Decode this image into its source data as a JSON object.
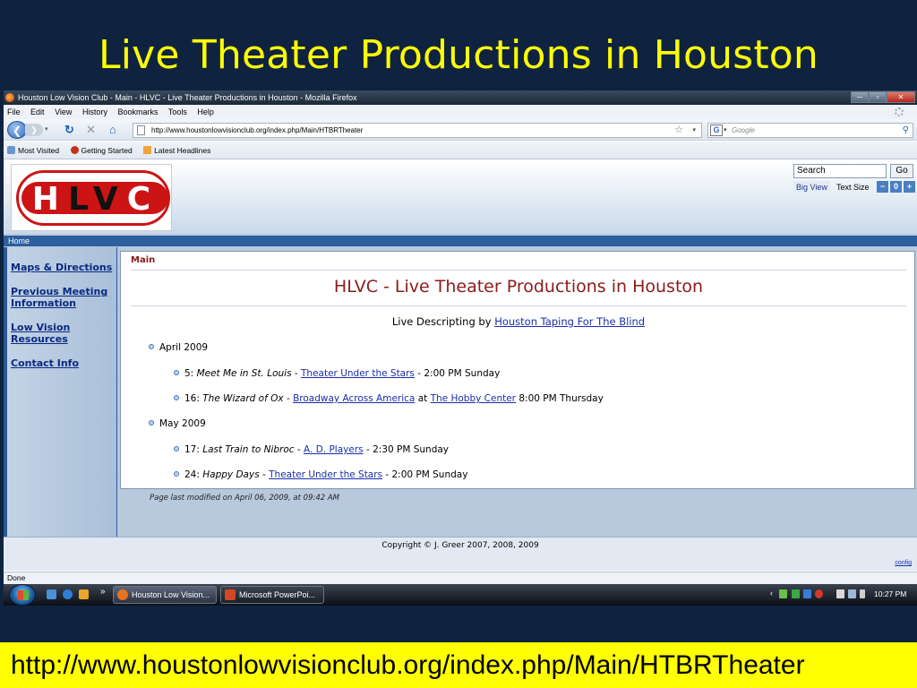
{
  "slide": {
    "title": "Live Theater Productions in Houston",
    "url_caption": "http://www.houstonlowvisionclub.org/index.php/Main/HTBRTheater"
  },
  "window": {
    "title": "Houston Low Vision Club - Main - HLVC - Live Theater Productions in Houston - Mozilla Firefox",
    "minimize": "─",
    "maximize": "▫",
    "close": "✕"
  },
  "menu": [
    "File",
    "Edit",
    "View",
    "History",
    "Bookmarks",
    "Tools",
    "Help"
  ],
  "navbar": {
    "url": "http://www.houstonlowvisionclub.org/index.php/Main/HTBRTheater",
    "search_placeholder": "Google",
    "search_engine": "G"
  },
  "bookmarks": [
    "Most Visited",
    "Getting Started",
    "Latest Headlines"
  ],
  "site": {
    "logo": {
      "left": "H",
      "middle": "LV",
      "right": "C"
    },
    "search_value": "Search",
    "go_label": "Go",
    "big_view": "Big View",
    "text_size": "Text Size",
    "size_minus": "−",
    "size_zero": "0",
    "size_plus": "+",
    "home_link": "Home",
    "sidebar": [
      "Maps & Directions",
      "Previous Meeting Information",
      "Low Vision Resources",
      "Contact Info"
    ],
    "breadcrumb": "Main",
    "page_title": "HLVC - Live Theater Productions in Houston",
    "subline": {
      "prefix": "Live Descripting by ",
      "link": "Houston Taping For The Blind"
    },
    "months": [
      {
        "label": "April 2009",
        "events": [
          {
            "day": "5: ",
            "title": "Meet Me in St. Louis",
            "sep": " - ",
            "venue": "Theater Under the Stars",
            "mid": "",
            "place": "",
            "time": " - 2:00 PM Sunday"
          },
          {
            "day": "16: ",
            "title": "The Wizard of Ox",
            "sep": " - ",
            "venue": "Broadway Across America",
            "mid": " at ",
            "place": "The Hobby Center",
            "time": " 8:00 PM Thursday"
          }
        ]
      },
      {
        "label": "May 2009",
        "events": [
          {
            "day": "17: ",
            "title": "Last Train to Nibroc",
            "sep": " - ",
            "venue": "A. D. Players",
            "mid": "",
            "place": "",
            "time": " - 2:30 PM Sunday"
          },
          {
            "day": "24: ",
            "title": "Happy Days",
            "sep": " - ",
            "venue": "Theater Under the Stars",
            "mid": "",
            "place": "",
            "time": " - 2:00 PM Sunday"
          }
        ]
      }
    ],
    "modified": "Page last modified on April 06, 2009, at 09:42 AM",
    "copyright": "Copyright © J. Greer 2007, 2008, 2009",
    "config": "config"
  },
  "status": "Done",
  "taskbar": {
    "tasks": [
      "Houston Low Vision...",
      "Microsoft PowerPoi..."
    ],
    "clock": "10:27 PM",
    "overflow": "»"
  }
}
